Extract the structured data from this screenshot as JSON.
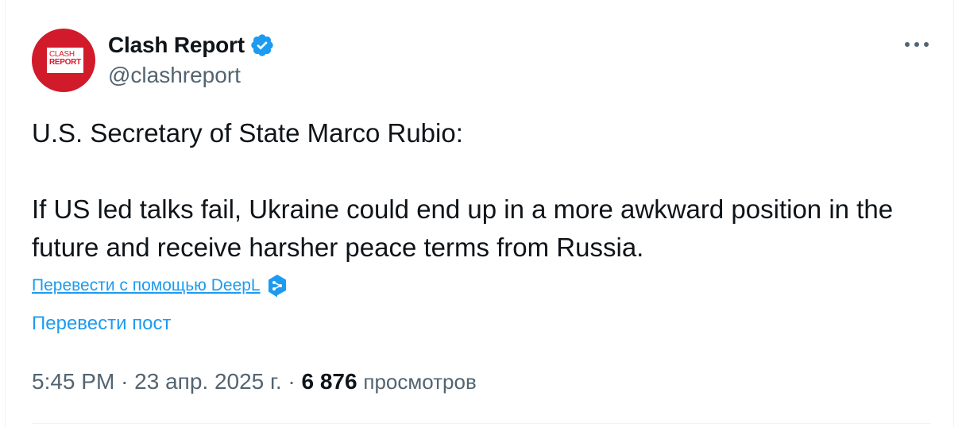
{
  "author": {
    "avatar_text_line1": "CLASH",
    "avatar_text_line2": "REPORT",
    "display_name": "Clash Report",
    "handle": "@clashreport",
    "verified_icon": "verified-badge-icon",
    "brand_color": "#d11a2a"
  },
  "post": {
    "line1": "U.S. Secretary of State Marco Rubio:",
    "line2": "If US led talks fail, Ukraine could end up in a more awkward position in the future and receive harsher peace terms from Russia."
  },
  "actions": {
    "deepl_label": "Перевести с помощью DeepL",
    "translate_label": "Перевести пост",
    "more_icon": "more-options-icon"
  },
  "meta": {
    "time": "5:45 PM",
    "date": "23 апр. 2025 г.",
    "separator": "·",
    "views_count": "6 876",
    "views_label": "просмотров"
  },
  "colors": {
    "accent": "#1d9bf0",
    "secondary_text": "#536471",
    "primary_text": "#0f1419"
  }
}
